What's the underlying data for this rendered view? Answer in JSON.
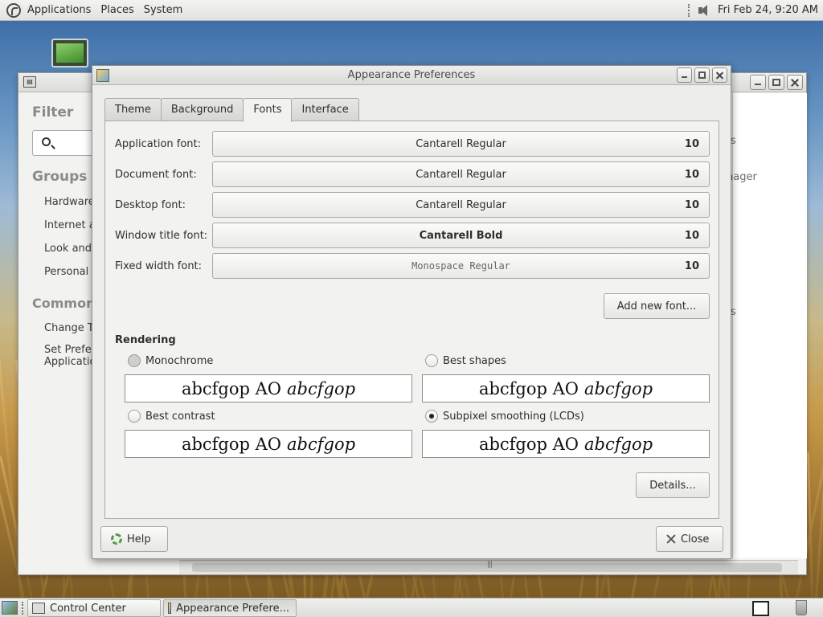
{
  "top_panel": {
    "menus": [
      "Applications",
      "Places",
      "System"
    ],
    "clock": "Fri Feb 24,  9:20 AM"
  },
  "control_center": {
    "filter_title": "Filter",
    "groups_title": "Groups",
    "groups": [
      "Hardware",
      "Internet a",
      "Look and",
      "Personal"
    ],
    "common_tasks_title": "Common T",
    "tasks": [
      "Change T",
      "Set Prefer",
      "Applicatio"
    ],
    "right_fragments": [
      "s",
      "nager",
      "s"
    ]
  },
  "dialog": {
    "title": "Appearance Preferences",
    "tabs": [
      "Theme",
      "Background",
      "Fonts",
      "Interface"
    ],
    "active_tab": "Fonts",
    "fonts": [
      {
        "label": "Application font:",
        "font": "Cantarell Regular",
        "size": "10"
      },
      {
        "label": "Document font:",
        "font": "Cantarell Regular",
        "size": "10"
      },
      {
        "label": "Desktop font:",
        "font": "Cantarell Regular",
        "size": "10"
      },
      {
        "label": "Window title font:",
        "font": "Cantarell Bold",
        "size": "10"
      },
      {
        "label": "Fixed width font:",
        "font": "Monospace Regular",
        "size": "10"
      }
    ],
    "add_font_button": "Add new font...",
    "rendering": {
      "title": "Rendering",
      "options": [
        {
          "label": "Monochrome",
          "checked": false
        },
        {
          "label": "Best shapes",
          "checked": false
        },
        {
          "label": "Best contrast",
          "checked": false
        },
        {
          "label": "Subpixel smoothing (LCDs)",
          "checked": true
        }
      ],
      "sample_regular": "abcfgop AO",
      "sample_italic": "abcfgop"
    },
    "details_button": "Details...",
    "help_button": "Help",
    "close_button": "Close"
  },
  "taskbar": {
    "tasks": [
      "Control Center",
      "Appearance Prefere..."
    ]
  }
}
